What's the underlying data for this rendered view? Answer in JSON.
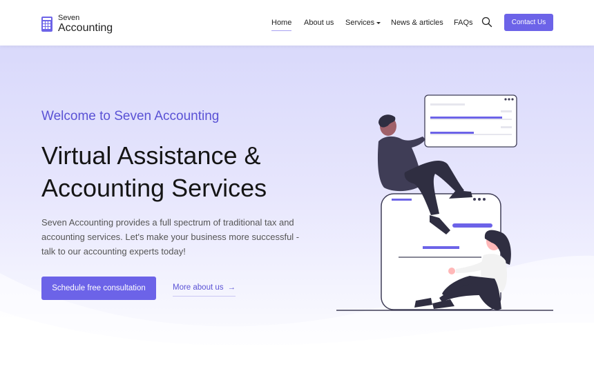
{
  "brand": {
    "top": "Seven",
    "bottom": "Accounting"
  },
  "nav": {
    "items": [
      {
        "label": "Home",
        "active": true
      },
      {
        "label": "About us"
      },
      {
        "label": "Services",
        "dropdown": true
      },
      {
        "label": "News & articles"
      },
      {
        "label": "FAQs"
      }
    ],
    "contact_label": "Contact Us"
  },
  "hero": {
    "eyebrow": "Welcome to Seven Accounting",
    "headline_line1": "Virtual Assistance &",
    "headline_line2": "Accounting Services",
    "description": "Seven Accounting provides a full spectrum of traditional tax and accounting services. Let's make your business more successful - talk to our accounting experts today!",
    "primary_cta": "Schedule free consultation",
    "secondary_cta": "More about us",
    "secondary_arrow": "→"
  },
  "colors": {
    "accent": "#6c63e8",
    "accent_text": "#5a52d5",
    "hero_top": "#d9d9fb",
    "dark_figure": "#2f2e41"
  },
  "icons": {
    "search": "search-icon",
    "logo": "calculator-icon",
    "arrow": "arrow-right-icon",
    "caret": "caret-down-icon"
  }
}
